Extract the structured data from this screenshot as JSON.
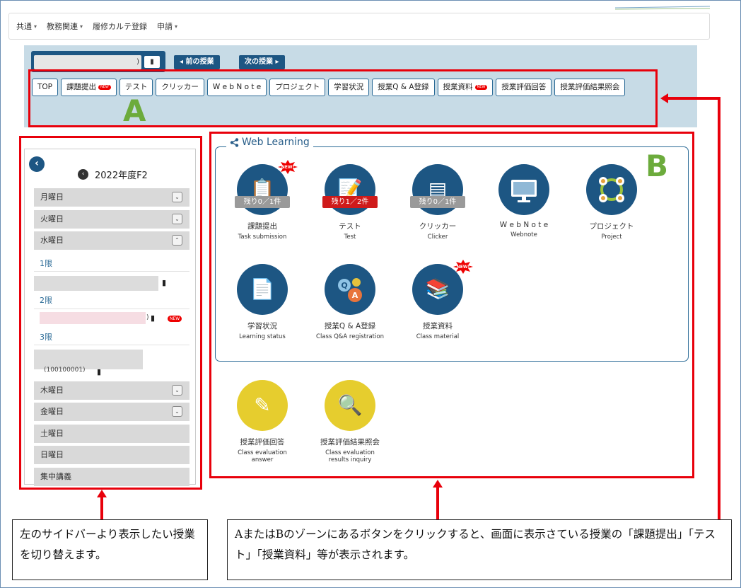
{
  "menu": {
    "items": [
      {
        "label": "共通",
        "caret": "▾"
      },
      {
        "label": "教務関連",
        "caret": "▾"
      },
      {
        "label": "履修カルテ登録",
        "caret": ""
      },
      {
        "label": "申請",
        "caret": "▾"
      }
    ]
  },
  "class_header": {
    "name_suffix": ")",
    "prev_label": "◂ 前の授業",
    "next_label": "次の授業 ▸"
  },
  "tabs": [
    {
      "label": "TOP",
      "new": false
    },
    {
      "label": "課題提出",
      "new": true
    },
    {
      "label": "テスト",
      "new": false
    },
    {
      "label": "クリッカー",
      "new": false
    },
    {
      "label": "W e b N o t e",
      "new": false
    },
    {
      "label": "プロジェクト",
      "new": false
    },
    {
      "label": "学習状況",
      "new": false
    },
    {
      "label": "授業Q & A登録",
      "new": false
    },
    {
      "label": "授業資料",
      "new": true
    },
    {
      "label": "授業評価回答",
      "new": false
    },
    {
      "label": "授業評価結果照会",
      "new": false
    }
  ],
  "new_badge": "NEW",
  "zone_labels": {
    "a": "A",
    "b": "B"
  },
  "sidebar": {
    "year": "2022年度F2",
    "days": [
      {
        "label": "月曜日",
        "toggle": "⌄"
      },
      {
        "label": "火曜日",
        "toggle": "⌄"
      },
      {
        "label": "水曜日",
        "toggle": "⌃"
      },
      {
        "label": "木曜日",
        "toggle": "⌄"
      },
      {
        "label": "金曜日",
        "toggle": "⌄"
      },
      {
        "label": "土曜日",
        "toggle": ""
      },
      {
        "label": "日曜日",
        "toggle": ""
      },
      {
        "label": "集中講義",
        "toggle": ""
      }
    ],
    "periods": [
      "1限",
      "2限",
      "3限"
    ],
    "slot2_suffix": ")",
    "slot3_code": "(100100001)"
  },
  "web_learning": {
    "title": "Web Learning",
    "items": [
      {
        "jp": "課題提出",
        "en": "Task submission",
        "remain": "残り0／1件",
        "remain_style": "gray",
        "new": true,
        "icon": "task-icon"
      },
      {
        "jp": "テスト",
        "en": "Test",
        "remain": "残り1／2件",
        "remain_style": "red",
        "new": false,
        "icon": "test-icon"
      },
      {
        "jp": "クリッカー",
        "en": "Clicker",
        "remain": "残り0／1件",
        "remain_style": "gray",
        "new": false,
        "icon": "clicker-icon"
      },
      {
        "jp": "W e b N o t e",
        "en": "Webnote",
        "remain": "",
        "remain_style": "",
        "new": false,
        "icon": "webnote-icon"
      },
      {
        "jp": "プロジェクト",
        "en": "Project",
        "remain": "",
        "remain_style": "",
        "new": false,
        "icon": "project-icon"
      },
      {
        "jp": "学習状況",
        "en": "Learning status",
        "remain": "",
        "remain_style": "",
        "new": false,
        "icon": "learning-status-icon"
      },
      {
        "jp": "授業Q & A登録",
        "en": "Class Q&A registration",
        "remain": "",
        "remain_style": "",
        "new": false,
        "icon": "qa-icon"
      },
      {
        "jp": "授業資料",
        "en": "Class material",
        "remain": "",
        "remain_style": "",
        "new": true,
        "icon": "class-material-icon"
      }
    ]
  },
  "evaluation": {
    "items": [
      {
        "jp": "授業評価回答",
        "en": "Class evaluation answer",
        "icon": "evaluation-answer-icon"
      },
      {
        "jp": "授業評価結果照会",
        "en": "Class evaluation results inquiry",
        "icon": "evaluation-inquiry-icon"
      }
    ]
  },
  "callouts": {
    "left": "左のサイドバーより表示したい授業を切り替えます。",
    "right": "AまたはBのゾーンにあるボタンをクリックすると、画面に表示さている授業の「課題提出」「テスト」「授業資料」等が表示されます。"
  },
  "colors": {
    "accent": "#1d5683",
    "zone_border": "#e8000b",
    "zone_label": "#6cab3c",
    "eval_yellow": "#e6cd2e"
  }
}
